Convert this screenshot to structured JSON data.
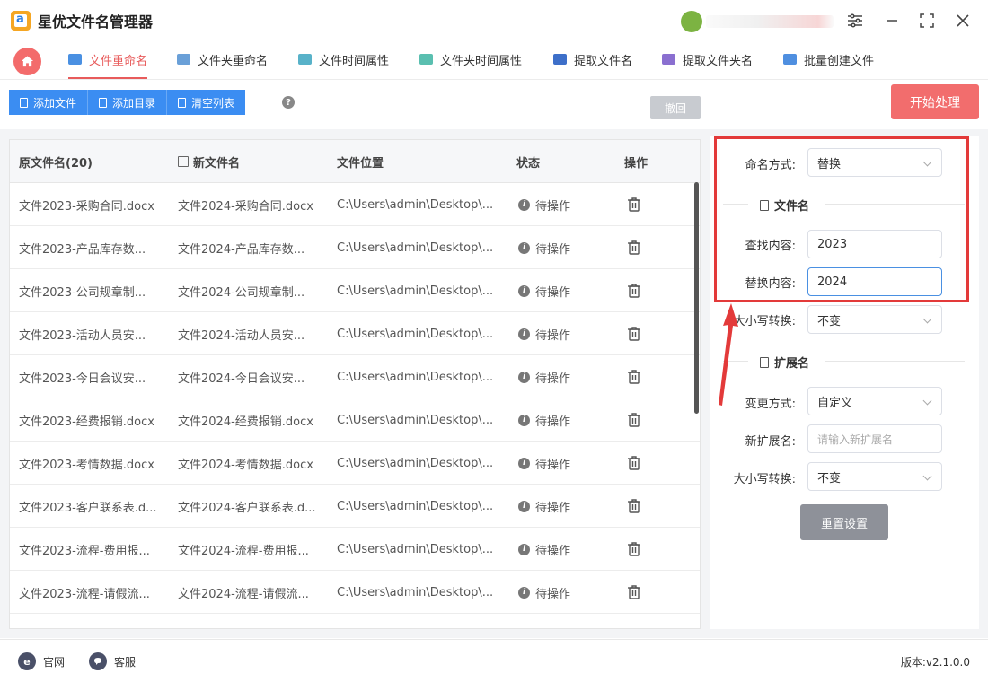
{
  "app": {
    "title": "星优文件名管理器"
  },
  "tabs": [
    {
      "label": "文件重命名",
      "active": true,
      "color": "#4a90e2"
    },
    {
      "label": "文件夹重命名",
      "active": false,
      "color": "#6aa0d8"
    },
    {
      "label": "文件时间属性",
      "active": false,
      "color": "#58b2c9"
    },
    {
      "label": "文件夹时间属性",
      "active": false,
      "color": "#5abfb0"
    },
    {
      "label": "提取文件名",
      "active": false,
      "color": "#3d6fc9"
    },
    {
      "label": "提取文件夹名",
      "active": false,
      "color": "#8a6fd0"
    },
    {
      "label": "批量创建文件",
      "active": false,
      "color": "#4f8fe0"
    }
  ],
  "toolbar": {
    "add_file": "添加文件",
    "add_dir": "添加目录",
    "clear_list": "清空列表",
    "help": "?",
    "undo": "撤回",
    "start": "开始处理"
  },
  "table": {
    "headers": {
      "original": "原文件名(20)",
      "new": "新文件名",
      "location": "文件位置",
      "status": "状态",
      "action": "操作"
    },
    "rows": [
      {
        "original": "文件2023-采购合同.docx",
        "new": "文件2024-采购合同.docx",
        "location": "C:\\Users\\admin\\Desktop\\...",
        "status": "待操作"
      },
      {
        "original": "文件2023-产品库存数...",
        "new": "文件2024-产品库存数...",
        "location": "C:\\Users\\admin\\Desktop\\...",
        "status": "待操作"
      },
      {
        "original": "文件2023-公司规章制...",
        "new": "文件2024-公司规章制...",
        "location": "C:\\Users\\admin\\Desktop\\...",
        "status": "待操作"
      },
      {
        "original": "文件2023-活动人员安...",
        "new": "文件2024-活动人员安...",
        "location": "C:\\Users\\admin\\Desktop\\...",
        "status": "待操作"
      },
      {
        "original": "文件2023-今日会议安...",
        "new": "文件2024-今日会议安...",
        "location": "C:\\Users\\admin\\Desktop\\...",
        "status": "待操作"
      },
      {
        "original": "文件2023-经费报销.docx",
        "new": "文件2024-经费报销.docx",
        "location": "C:\\Users\\admin\\Desktop\\...",
        "status": "待操作"
      },
      {
        "original": "文件2023-考情数据.docx",
        "new": "文件2024-考情数据.docx",
        "location": "C:\\Users\\admin\\Desktop\\...",
        "status": "待操作"
      },
      {
        "original": "文件2023-客户联系表.d...",
        "new": "文件2024-客户联系表.d...",
        "location": "C:\\Users\\admin\\Desktop\\...",
        "status": "待操作"
      },
      {
        "original": "文件2023-流程-费用报...",
        "new": "文件2024-流程-费用报...",
        "location": "C:\\Users\\admin\\Desktop\\...",
        "status": "待操作"
      },
      {
        "original": "文件2023-流程-请假流...",
        "new": "文件2024-流程-请假流...",
        "location": "C:\\Users\\admin\\Desktop\\...",
        "status": "待操作"
      }
    ]
  },
  "panel": {
    "naming_mode_label": "命名方式:",
    "naming_mode_value": "替换",
    "filename_section": "文件名",
    "find_label": "查找内容:",
    "find_value": "2023",
    "replace_label": "替换内容:",
    "replace_value": "2024",
    "case_label": "大小写转换:",
    "case_value": "不变",
    "ext_section": "扩展名",
    "ext_mode_label": "变更方式:",
    "ext_mode_value": "自定义",
    "new_ext_label": "新扩展名:",
    "new_ext_placeholder": "请输入新扩展名",
    "ext_case_label": "大小写转换:",
    "ext_case_value": "不变",
    "reset": "重置设置"
  },
  "footer": {
    "website": "官网",
    "website_icon": "e",
    "support": "客服",
    "version_label": "版本:",
    "version": "v2.1.0.0"
  },
  "colors": {
    "accent": "#e85b5b",
    "primary_blue": "#3b8df2",
    "annotation_red": "#e33a3a"
  }
}
